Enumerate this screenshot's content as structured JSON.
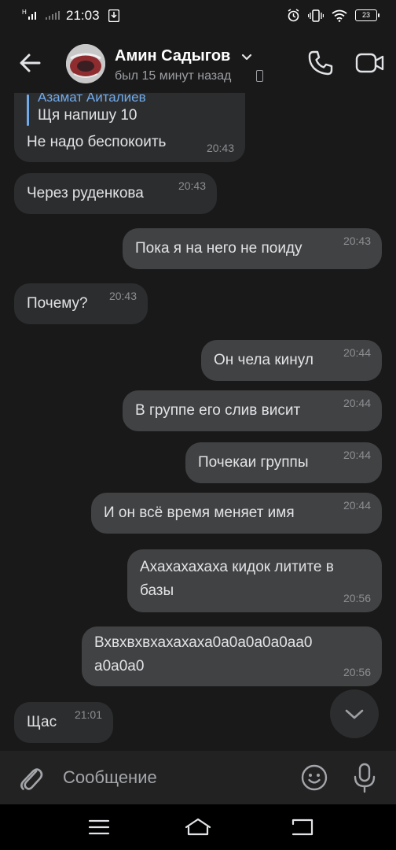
{
  "status_bar": {
    "time": "21:03",
    "battery": "23",
    "network": "H"
  },
  "header": {
    "name": "Амин Садыгов",
    "status": "был 15 минут назад"
  },
  "messages": [
    {
      "dir": "in",
      "reply_author": "Азамат Аиталиев",
      "reply_text": "Щя напишу 10",
      "text": "Не надо беспокоить",
      "time": "20:43"
    },
    {
      "dir": "in",
      "text": "Через руденкова",
      "time": "20:43"
    },
    {
      "dir": "out",
      "text": "Пока я на него не поиду",
      "time": "20:43"
    },
    {
      "dir": "in",
      "text": "Почему?",
      "time": "20:43"
    },
    {
      "dir": "out",
      "text": "Он чела кинул",
      "time": "20:44"
    },
    {
      "dir": "out",
      "text": "В группе его слив висит",
      "time": "20:44"
    },
    {
      "dir": "out",
      "text": "Почекаи группы",
      "time": "20:44"
    },
    {
      "dir": "out",
      "text": "И он всё время меняет имя",
      "time": "20:44"
    },
    {
      "dir": "out",
      "text_line1": "Ахахахахаха кидок литите в",
      "text_line2": "базы",
      "time": "20:56"
    },
    {
      "dir": "out",
      "text_line1": "Вхвхвхвхахахаха0а0а0а0а0аа0",
      "text_line2": "а0а0а0",
      "time": "20:56"
    },
    {
      "dir": "in",
      "text": "Щас",
      "time": "21:01"
    }
  ],
  "composer": {
    "placeholder": "Сообщение"
  },
  "icons": {
    "back": "arrow-left-icon",
    "chevron": "chevron-down-icon",
    "call": "phone-icon",
    "video": "video-camera-icon",
    "attach": "paperclip-icon",
    "emoji": "smiley-icon",
    "mic": "microphone-icon",
    "scroll": "chevron-down-icon"
  },
  "colors": {
    "background": "#19191a",
    "bubble_in": "#2c2d2e",
    "bubble_out": "#414243",
    "accent": "#71aaeb"
  }
}
